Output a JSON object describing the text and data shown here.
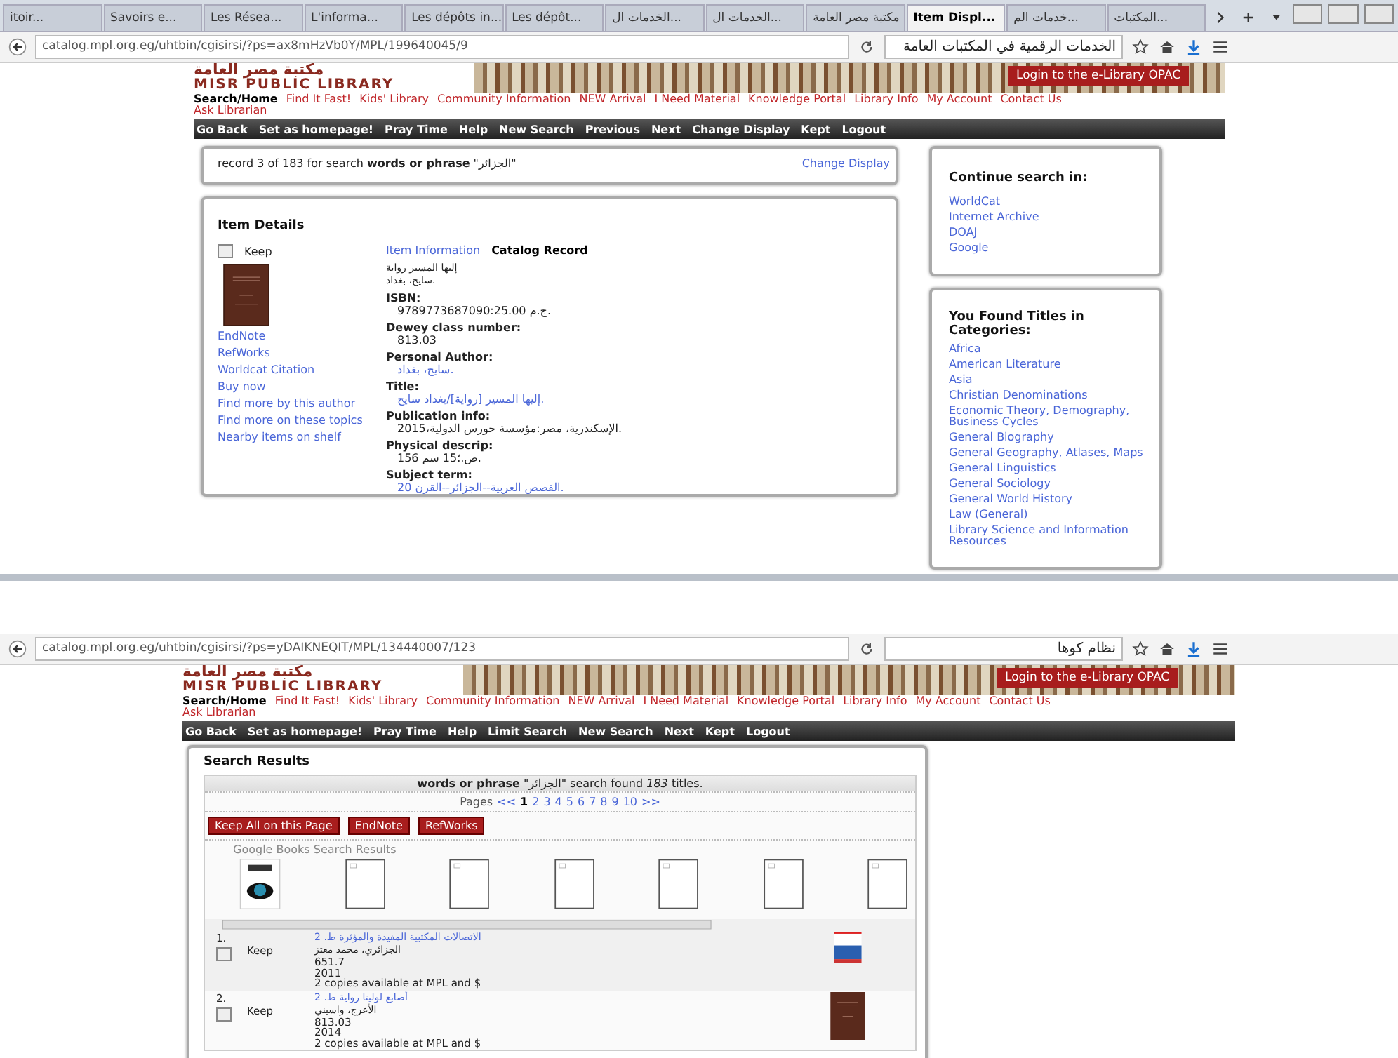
{
  "top_window": {
    "tabs": [
      {
        "label": "itoir...",
        "selected": false
      },
      {
        "label": "Savoirs e...",
        "selected": false
      },
      {
        "label": "Les Résea...",
        "selected": false
      },
      {
        "label": "L'informa...",
        "selected": false
      },
      {
        "label": "Les dépôts in...",
        "selected": false
      },
      {
        "label": "Les dépôt...",
        "selected": false
      },
      {
        "label": "الخدمات ال...",
        "selected": false
      },
      {
        "label": "الخدمات ال...",
        "selected": false
      },
      {
        "label": "مكتبة مصر العامة",
        "selected": false
      },
      {
        "label": "Item Displ...",
        "selected": true
      },
      {
        "label": "خدمات الم...",
        "selected": false
      },
      {
        "label": "المكتبات...",
        "selected": false
      }
    ],
    "address": "catalog.mpl.org.eg/uhtbin/cgisirsi/?ps=ax8mHzVb0Y/MPL/199640045/9",
    "search_value": "الخدمات الرقمية في المكتبات العامة",
    "site": {
      "logo_arabic": "مكتبة مصر العامة",
      "logo": "MISR PUBLIC LIBRARY",
      "login_button": "Login to the e-Library OPAC",
      "nav_links": [
        "Search/Home",
        "Find It Fast!",
        "Kids' Library",
        "Community Information",
        "NEW Arrival",
        "I Need Material",
        "Knowledge Portal",
        "Library Info",
        "My Account",
        "Contact Us"
      ],
      "second_link": "Ask Librarian",
      "toolbar": [
        "Go Back",
        "Set as homepage!",
        "Pray Time",
        "Help",
        "New Search",
        "Previous",
        "Next",
        "Change Display",
        "Kept",
        "Logout"
      ]
    },
    "record_bar": {
      "text": "record 3 of 183 for search **words or phrase** \"الجزائر\"",
      "link": "Change Display"
    },
    "item_details": {
      "heading": "Item Details",
      "keep": {
        "label": "Keep",
        "checked": false
      },
      "links": [
        "EndNote",
        "RefWorks",
        "Worldcat Citation",
        "Buy now",
        "Find more by this author",
        "Find more on these topics",
        "Nearby items on shelf"
      ],
      "tabs": [
        {
          "label": "Item Information",
          "selected": false
        },
        {
          "label": "Catalog Record",
          "selected": true
        }
      ],
      "title_lines": [
        "إليها المسير رواية",
        "سايح، بغداد."
      ],
      "fields": [
        {
          "label": "ISBN:",
          "value": "9789773687090:25.00 ج.م.",
          "kind": "text"
        },
        {
          "label": "Dewey class number:",
          "value": "813.03",
          "kind": "text"
        },
        {
          "label": "Personal Author:",
          "value": "سايح، بغداد.",
          "kind": "link"
        },
        {
          "label": "Title:",
          "value": "إليها المسير [رواية]/بغداد سايح.",
          "kind": "link"
        },
        {
          "label": "Publication info:",
          "value": "الإسكندرية، مصر:مؤسسة حورس الدولية،2015.",
          "kind": "text"
        },
        {
          "label": "Physical descrip:",
          "value": "156 ص.؛15 سم.",
          "kind": "text"
        },
        {
          "label": "Subject term:",
          "value": "القصص العربية--الجزائر--القرن 20.",
          "kind": "link"
        }
      ]
    },
    "continue_search": {
      "heading": "Continue search in:",
      "links": [
        "WorldCat",
        "Internet Archive",
        "DOAJ",
        "Google"
      ]
    },
    "categories": {
      "heading": "You Found Titles in Categories:",
      "links": [
        "Africa",
        "American Literature",
        "Asia",
        "Christian Denominations",
        "Economic Theory, Demography, Business Cycles",
        "General Biography",
        "General Geography, Atlases, Maps",
        "General Linguistics",
        "General Sociology",
        "General World History",
        "Law (General)",
        "Library Science and Information Resources"
      ]
    }
  },
  "bottom_window": {
    "address": "catalog.mpl.org.eg/uhtbin/cgisirsi/?ps=yDAIKNEQIT/MPL/134440007/123",
    "search_value": "نظام كوها",
    "site": {
      "logo_arabic": "مكتبة مصر العامة",
      "logo": "MISR PUBLIC LIBRARY",
      "login_button": "Login to the e-Library OPAC",
      "nav_links": [
        "Search/Home",
        "Find It Fast!",
        "Kids' Library",
        "Community Information",
        "NEW Arrival",
        "I Need Material",
        "Knowledge Portal",
        "Library Info",
        "My Account",
        "Contact Us"
      ],
      "second_link": "Ask Librarian",
      "toolbar": [
        "Go Back",
        "Set as homepage!",
        "Pray Time",
        "Help",
        "Limit Search",
        "New Search",
        "Next",
        "Kept",
        "Logout"
      ]
    },
    "results": {
      "heading": "Search Results",
      "summary": "**words or phrase** \"الجزائر\" search found *183* titles.",
      "pages_label": "Pages",
      "pages": [
        {
          "label": "<<",
          "selected": false
        },
        {
          "label": "1",
          "selected": true
        },
        {
          "label": "2",
          "selected": false
        },
        {
          "label": "3",
          "selected": false
        },
        {
          "label": "4",
          "selected": false
        },
        {
          "label": "5",
          "selected": false
        },
        {
          "label": "6",
          "selected": false
        },
        {
          "label": "7",
          "selected": false
        },
        {
          "label": "8",
          "selected": false
        },
        {
          "label": "9",
          "selected": false
        },
        {
          "label": "10",
          "selected": false
        },
        {
          "label": ">>",
          "selected": false
        }
      ],
      "buttons": [
        "Keep All on this Page",
        "EndNote",
        "RefWorks"
      ],
      "google_heading": "Google Books Search Results",
      "covers": [
        {
          "kind": "image"
        },
        {
          "kind": "blank"
        },
        {
          "kind": "blank"
        },
        {
          "kind": "blank"
        },
        {
          "kind": "blank"
        },
        {
          "kind": "blank"
        },
        {
          "kind": "blank"
        }
      ],
      "items": [
        {
          "number": "1.",
          "keep": {
            "label": "Keep",
            "checked": false
          },
          "title": "الاتصالات المكتبية المفيدة والمؤثرة ط. 2",
          "author": "الجزائري، محمد معتز",
          "call_number": "651.7",
          "year": "2011",
          "availability": "2 copies available at MPL and $",
          "kind": "photo"
        },
        {
          "number": "2.",
          "keep": {
            "label": "Keep",
            "checked": false
          },
          "title": "أصابع لوليتا رواية ط. 2",
          "author": "الأعرج، واسيني",
          "call_number": "813.03",
          "year": "2014",
          "availability": "2 copies available at MPL and $",
          "kind": "book"
        }
      ]
    }
  }
}
